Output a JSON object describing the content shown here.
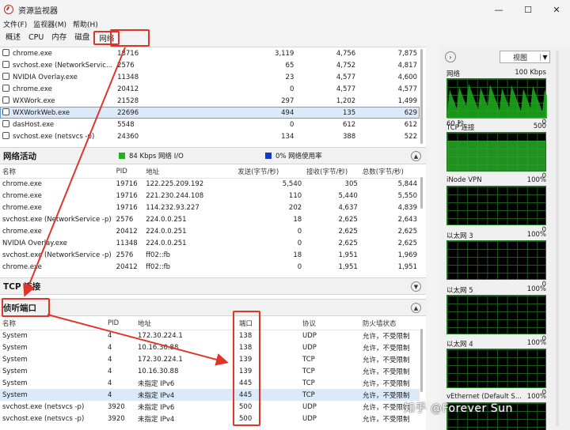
{
  "window": {
    "title": "资源监视器",
    "controls": {
      "minimize": "—",
      "maximize": "☐",
      "close": "✕"
    }
  },
  "menu": [
    "文件(F)",
    "监视器(M)",
    "帮助(H)"
  ],
  "tabs": [
    {
      "label": "概述"
    },
    {
      "label": "CPU"
    },
    {
      "label": "内存"
    },
    {
      "label": "磁盘"
    },
    {
      "label": "网络",
      "active": true
    }
  ],
  "processes": [
    {
      "name": "chrome.exe",
      "pid": "18716",
      "c1": "3,119",
      "c2": "4,756",
      "c3": "7,875"
    },
    {
      "name": "svchost.exe (NetworkServic...",
      "pid": "2576",
      "c1": "65",
      "c2": "4,752",
      "c3": "4,817"
    },
    {
      "name": "NVIDIA Overlay.exe",
      "pid": "11348",
      "c1": "23",
      "c2": "4,577",
      "c3": "4,600"
    },
    {
      "name": "chrome.exe",
      "pid": "20412",
      "c1": "0",
      "c2": "4,577",
      "c3": "4,577"
    },
    {
      "name": "WXWork.exe",
      "pid": "21528",
      "c1": "297",
      "c2": "1,202",
      "c3": "1,499"
    },
    {
      "name": "WXWorkWeb.exe",
      "pid": "22696",
      "c1": "494",
      "c2": "135",
      "c3": "629",
      "selected": true
    },
    {
      "name": "dasHost.exe",
      "pid": "5548",
      "c1": "0",
      "c2": "612",
      "c3": "612"
    },
    {
      "name": "svchost.exe (netsvcs -p)",
      "pid": "24360",
      "c1": "134",
      "c2": "388",
      "c3": "522"
    }
  ],
  "network_activity": {
    "title": "网络活动",
    "io_label": "84 Kbps 网络 I/O",
    "io_color": "#1db31d",
    "usage_label": "0% 网络使用率",
    "usage_color": "#1538c9",
    "columns": [
      "名称",
      "PID",
      "地址",
      "发送(字节/秒)",
      "接收(字节/秒)",
      "总数(字节/秒)"
    ],
    "rows": [
      [
        "chrome.exe",
        "19716",
        "122.225.209.192",
        "5,540",
        "305",
        "5,844"
      ],
      [
        "chrome.exe",
        "19716",
        "221.230.244.108",
        "110",
        "5,440",
        "5,550"
      ],
      [
        "chrome.exe",
        "19716",
        "114.232.93.227",
        "202",
        "4,637",
        "4,839"
      ],
      [
        "svchost.exe (NetworkService -p)",
        "2576",
        "224.0.0.251",
        "18",
        "2,625",
        "2,643"
      ],
      [
        "chrome.exe",
        "20412",
        "224.0.0.251",
        "0",
        "2,625",
        "2,625"
      ],
      [
        "NVIDIA Overlay.exe",
        "11348",
        "224.0.0.251",
        "0",
        "2,625",
        "2,625"
      ],
      [
        "svchost.exe (NetworkService -p)",
        "2576",
        "ff02::fb",
        "18",
        "1,951",
        "1,969"
      ],
      [
        "chrome.exe",
        "20412",
        "ff02::fb",
        "0",
        "1,951",
        "1,951"
      ]
    ]
  },
  "tcp": {
    "title": "TCP 连接"
  },
  "listening": {
    "title": "侦听端口",
    "columns": [
      "名称",
      "PID",
      "地址",
      "端口",
      "协议",
      "防火墙状态"
    ],
    "rows": [
      [
        "System",
        "4",
        "172.30.224.1",
        "138",
        "UDP",
        "允许，不受限制"
      ],
      [
        "System",
        "4",
        "10.16.30.88",
        "138",
        "UDP",
        "允许，不受限制"
      ],
      [
        "System",
        "4",
        "172.30.224.1",
        "139",
        "TCP",
        "允许，不受限制"
      ],
      [
        "System",
        "4",
        "10.16.30.88",
        "139",
        "TCP",
        "允许，不受限制"
      ],
      [
        "System",
        "4",
        "未指定 IPv6",
        "445",
        "TCP",
        "允许，不受限制"
      ],
      [
        "System",
        "4",
        "未指定 IPv4",
        "445",
        "TCP",
        "允许，不受限制"
      ],
      [
        "svchost.exe (netsvcs -p)",
        "3920",
        "未指定 IPv6",
        "500",
        "UDP",
        "允许，不受限制"
      ],
      [
        "svchost.exe (netsvcs -p)",
        "3920",
        "未指定 IPv4",
        "500",
        "UDP",
        "允许，不受限制"
      ]
    ]
  },
  "right_panel": {
    "view_label": "视图",
    "graphs": [
      {
        "name": "网络",
        "max": "100 Kbps",
        "bottom_left": "60 秒",
        "bottom_right": "0"
      },
      {
        "name": "TCP 连接",
        "max": "500",
        "bottom_right": "0"
      },
      {
        "name": "iNode VPN",
        "max": "100%",
        "bottom_right": "0"
      },
      {
        "name": "以太网 3",
        "max": "100%",
        "bottom_right": "0"
      },
      {
        "name": "以太网 5",
        "max": "100%",
        "bottom_right": "0"
      },
      {
        "name": "以太网 4",
        "max": "100%",
        "bottom_right": "0"
      },
      {
        "name": "vEthernet (Default S...",
        "max": "100%"
      }
    ]
  },
  "watermark": "知乎 @Forever Sun"
}
